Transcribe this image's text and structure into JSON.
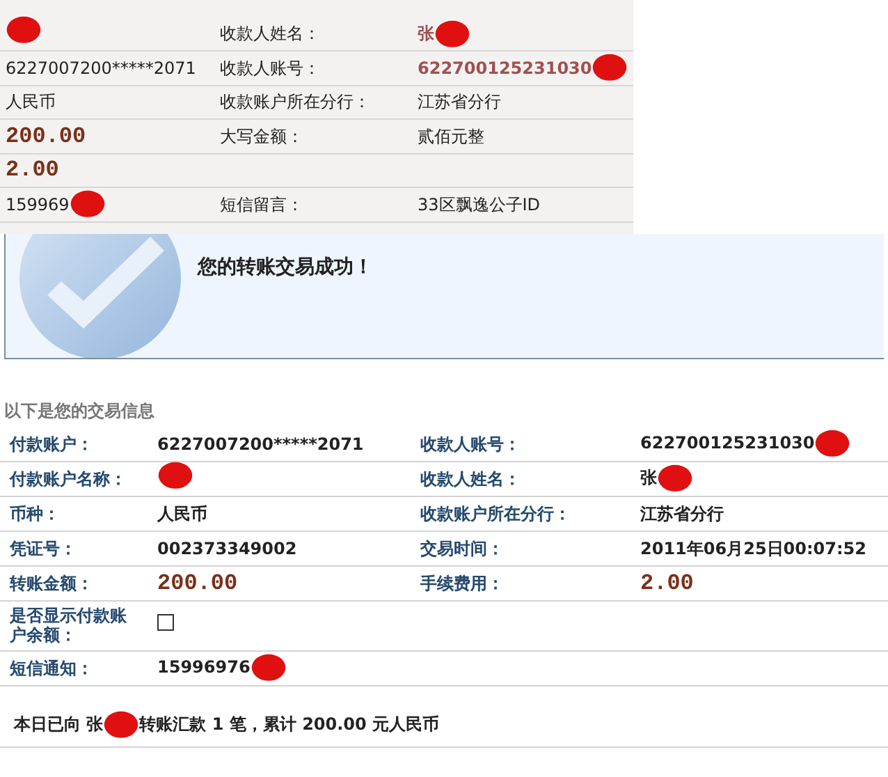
{
  "top_details": {
    "rows": [
      {
        "value_1": {
          "redacted": true
        },
        "label": "收款人姓名：",
        "value_2": {
          "text": "张",
          "kind": "payee",
          "redacted": true
        }
      },
      {
        "value_1": {
          "text": "6227007200*****2071"
        },
        "label": "收款人账号：",
        "value_2": {
          "text": "622700125231030",
          "kind": "payee",
          "redacted": true
        }
      },
      {
        "value_1": {
          "text": "人民币"
        },
        "label": "收款账户所在分行：",
        "value_2": {
          "text": "江苏省分行"
        }
      },
      {
        "value_1": {
          "text": "200.00",
          "kind": "amount"
        },
        "label": "大写金额：",
        "value_2": {
          "text": "贰佰元整"
        }
      },
      {
        "value_1": {
          "text": "2.00",
          "kind": "amount"
        }
      },
      {
        "value_1": {
          "text": "159969",
          "redacted": true
        },
        "label": "短信留言：",
        "value_2": {
          "text": "33区飘逸公子ID"
        }
      }
    ]
  },
  "success_banner": {
    "message": "您的转账交易成功！"
  },
  "transaction_info": {
    "heading": "以下是您的交易信息",
    "rows": [
      {
        "label_1": "付款账户：",
        "value_1": {
          "text": "6227007200*****2071"
        },
        "label_2": "收款人账号：",
        "value_2": {
          "text": "622700125231030",
          "redacted": true
        }
      },
      {
        "label_1": "付款账户名称：",
        "value_1": {
          "redacted": true
        },
        "label_2": "收款人姓名：",
        "value_2": {
          "text": "张",
          "redacted": true
        }
      },
      {
        "label_1": "币种：",
        "value_1": {
          "text": "人民币"
        },
        "label_2": "收款账户所在分行：",
        "value_2": {
          "text": "江苏省分行"
        }
      },
      {
        "label_1": "凭证号：",
        "value_1": {
          "text": "002373349002"
        },
        "label_2": "交易时间：",
        "value_2": {
          "text": "2011年06月25日00:07:52"
        }
      },
      {
        "label_1": "转账金额：",
        "value_1": {
          "text": "200.00",
          "kind": "amount"
        },
        "label_2": "手续费用：",
        "value_2": {
          "text": "2.00",
          "kind": "amount"
        }
      },
      {
        "label_1": "是否显示付款账户余额：",
        "checkbox": {
          "checked": false
        }
      },
      {
        "label_1": "短信通知：",
        "value_1": {
          "text": "15996976",
          "redacted": true
        }
      }
    ],
    "summary": {
      "before": "本日已向 张",
      "after": "转账汇款 1 笔，累计 200.00 元人民币",
      "redacted": true
    }
  }
}
